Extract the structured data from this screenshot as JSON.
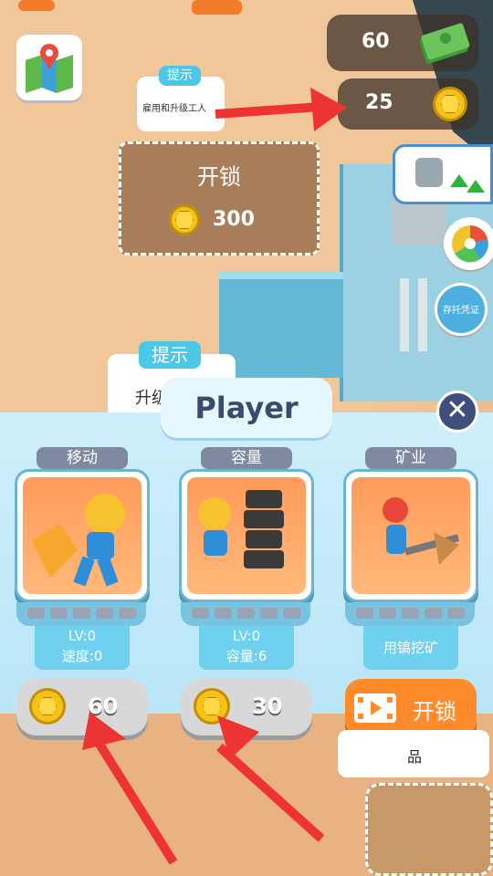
{
  "hud": {
    "cash_value": "60",
    "coin_value": "25"
  },
  "hint_bubble": {
    "tag": "提示",
    "text": "雇用和升级工人"
  },
  "unlock_plot": {
    "title": "开锁",
    "price": "300"
  },
  "side_buttons": {
    "deposit_label": "存托凭证"
  },
  "hint_bubble_2": {
    "tag": "提示",
    "text": "升级"
  },
  "panel": {
    "title": "Player",
    "close_symbol": "✕",
    "cards": [
      {
        "label": "移动",
        "stat1": "LV:0",
        "stat2": "速度:0",
        "price": "60"
      },
      {
        "label": "容量",
        "stat1": "LV:0",
        "stat2": "容量:6",
        "price": "30"
      },
      {
        "label": "矿业",
        "stat1": "用镐挖矿",
        "stat2": "",
        "button": "开锁"
      }
    ]
  },
  "bottom_fragment": "品",
  "colors": {
    "accent_blue": "#4dc7e6",
    "panel_bg": "#b9e6f7",
    "unlock_orange": "#ff8b2a",
    "coin_gold": "#f4c21a"
  }
}
